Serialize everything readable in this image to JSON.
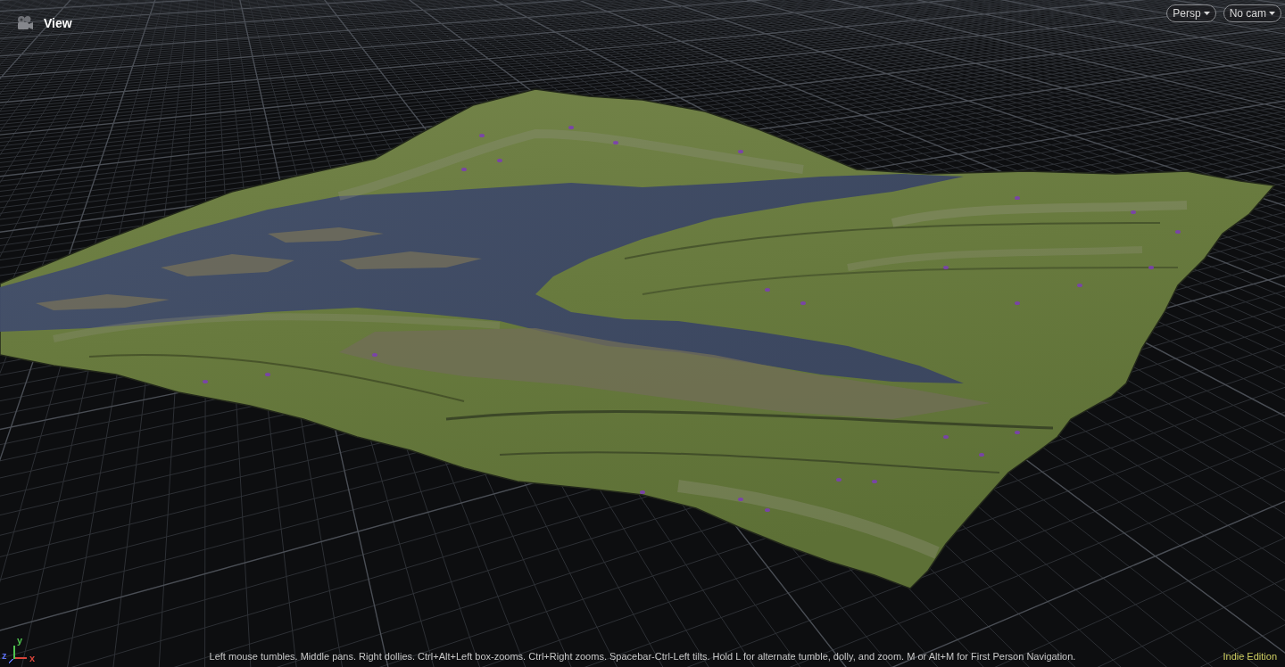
{
  "viewport": {
    "title": "View",
    "camera_menus": [
      {
        "label": "Persp"
      },
      {
        "label": "No cam"
      }
    ],
    "axes": [
      {
        "label": "x",
        "color": "#d8453c"
      },
      {
        "label": "y",
        "color": "#4fc44f"
      },
      {
        "label": "z",
        "color": "#5b6ff0"
      }
    ],
    "hint": "Left mouse tumbles. Middle pans. Right dollies. Ctrl+Alt+Left box-zooms. Ctrl+Right zooms. Spacebar-Ctrl-Left tilts. Hold L for alternate tumble, dolly, and zoom. M or Alt+M for First Person Navigation.",
    "edition": "Indie Edition"
  }
}
